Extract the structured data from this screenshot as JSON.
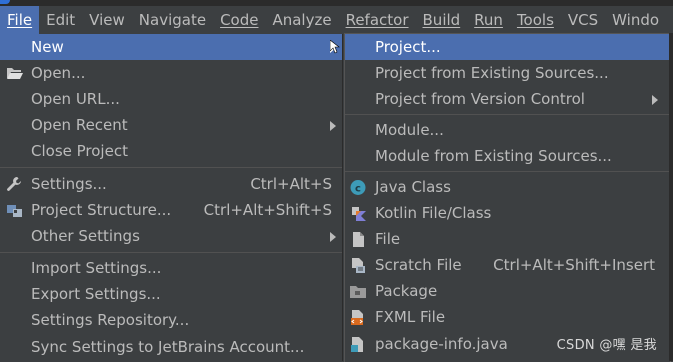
{
  "menubar": {
    "items": [
      "File",
      "Edit",
      "View",
      "Navigate",
      "Code",
      "Analyze",
      "Refactor",
      "Build",
      "Run",
      "Tools",
      "VCS",
      "Windo"
    ]
  },
  "file_menu": {
    "items": [
      {
        "label": "New",
        "shortcut": "",
        "submenu": true
      },
      {
        "label": "Open...",
        "shortcut": "",
        "submenu": false,
        "icon": "folder-open-icon"
      },
      {
        "label": "Open URL...",
        "shortcut": "",
        "submenu": false
      },
      {
        "label": "Open Recent",
        "shortcut": "",
        "submenu": true
      },
      {
        "label": "Close Project",
        "shortcut": "",
        "submenu": false
      },
      {
        "label": "Settings...",
        "shortcut": "Ctrl+Alt+S",
        "submenu": false,
        "icon": "wrench-icon"
      },
      {
        "label": "Project Structure...",
        "shortcut": "Ctrl+Alt+Shift+S",
        "submenu": false,
        "icon": "project-structure-icon"
      },
      {
        "label": "Other Settings",
        "shortcut": "",
        "submenu": true
      },
      {
        "label": "Import Settings...",
        "shortcut": "",
        "submenu": false
      },
      {
        "label": "Export Settings...",
        "shortcut": "",
        "submenu": false
      },
      {
        "label": "Settings Repository...",
        "shortcut": "",
        "submenu": false
      },
      {
        "label": "Sync Settings to JetBrains Account...",
        "shortcut": "",
        "submenu": false
      }
    ]
  },
  "new_menu": {
    "items": [
      {
        "label": "Project...",
        "shortcut": "",
        "submenu": false
      },
      {
        "label": "Project from Existing Sources...",
        "shortcut": "",
        "submenu": false
      },
      {
        "label": "Project from Version Control",
        "shortcut": "",
        "submenu": true
      },
      {
        "label": "Module...",
        "shortcut": "",
        "submenu": false
      },
      {
        "label": "Module from Existing Sources...",
        "shortcut": "",
        "submenu": false
      },
      {
        "label": "Java Class",
        "shortcut": "",
        "submenu": false,
        "icon": "java-class-icon"
      },
      {
        "label": "Kotlin File/Class",
        "shortcut": "",
        "submenu": false,
        "icon": "kotlin-icon"
      },
      {
        "label": "File",
        "shortcut": "",
        "submenu": false,
        "icon": "file-icon"
      },
      {
        "label": "Scratch File",
        "shortcut": "Ctrl+Alt+Shift+Insert",
        "submenu": false,
        "icon": "scratch-file-icon"
      },
      {
        "label": "Package",
        "shortcut": "",
        "submenu": false,
        "icon": "package-icon"
      },
      {
        "label": "FXML File",
        "shortcut": "",
        "submenu": false,
        "icon": "fxml-icon"
      },
      {
        "label": "package-info.java",
        "shortcut": "",
        "submenu": false,
        "icon": "package-info-icon"
      }
    ]
  },
  "watermark": "CSDN @嘿 是我",
  "colors": {
    "background": "#3c3f41",
    "highlight": "#4b6eaf",
    "text": "#bbbbbb"
  }
}
